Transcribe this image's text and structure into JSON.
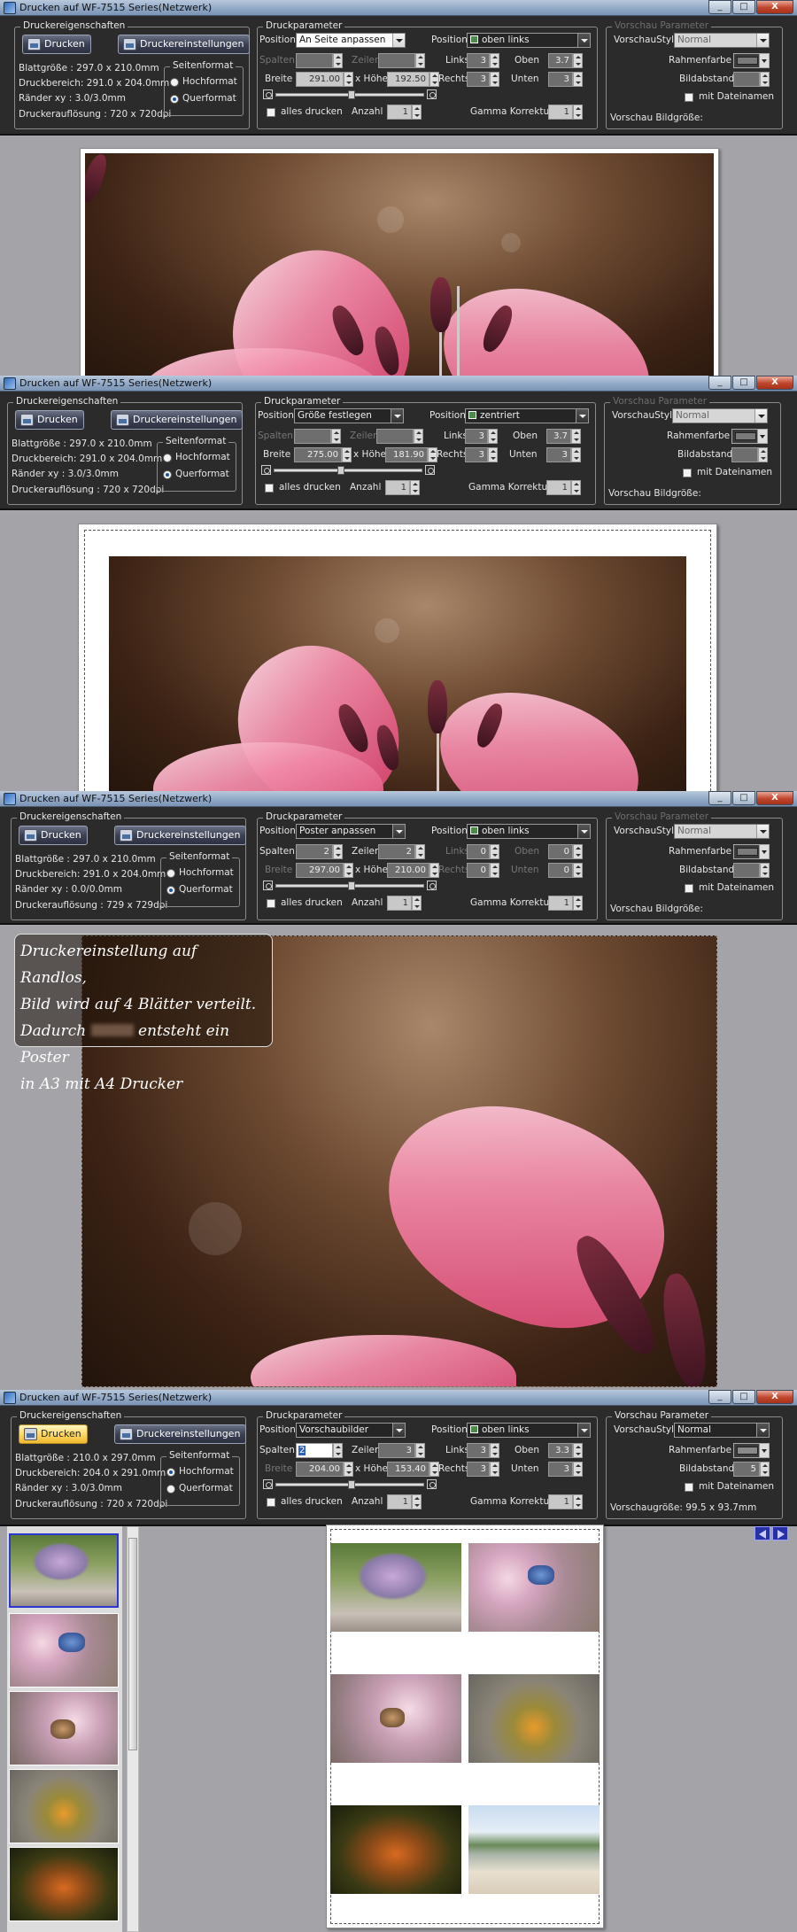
{
  "window": {
    "title": "Drucken auf WF-7515 Series(Netzwerk)",
    "buttons": {
      "minimize": "_",
      "maximize": "□",
      "close": "X"
    }
  },
  "labels": {
    "druckereigenschaften": "Druckereigenschaften",
    "drucken": "Drucken",
    "druckereinstellungen": "Druckereinstellungen",
    "blattgroesse": "Blattgröße",
    "druckbereich": "Druckbereich:",
    "raender": "Ränder xy",
    "druckaufloesung": "Druckerauflösung :",
    "seitenformat": "Seitenformat",
    "hochformat": "Hochformat",
    "querformat": "Querformat",
    "druckparameter": "Druckparameter",
    "position": "Position",
    "spalten": "Spalten",
    "zeilen": "Zeilen",
    "links": "Links",
    "oben": "Oben",
    "rechts": "Rechts",
    "unten": "Unten",
    "breite": "Breite",
    "x_hoehe": "x Höhe",
    "alles_drucken": "alles drucken",
    "anzahl": "Anzahl",
    "gamma": "Gamma Korrektur",
    "vorschau_parameter": "Vorschau Parameter",
    "vorschaustyle": "VorschauStyle",
    "rahmenfarbe": "Rahmenfarbe",
    "bildabstand": "Bildabstand",
    "mit_dateinamen": "mit Dateinamen"
  },
  "screens": [
    {
      "blatt": ": 297.0 x 210.0mm",
      "druckbereich": " 291.0 x 204.0mm",
      "raender": ": 3.0/3.0mm",
      "aufloesung": " 720 x 720dpi",
      "orientation": "Querformat",
      "position_mode": "An Seite anpassen",
      "position_anchor": "oben links",
      "spalten": "",
      "zeilen": "",
      "links": "3",
      "oben": "3.7",
      "rechts": "3",
      "unten": "3",
      "breite": "291.00",
      "hoehe": "192.50",
      "anzahl": "1",
      "gamma": "1",
      "vorschau_style": "Normal",
      "bildabstand": "",
      "bildgroesse": "Vorschau Bildgröße:",
      "preview_active": false
    },
    {
      "blatt": ": 297.0 x 210.0mm",
      "druckbereich": " 291.0 x 204.0mm",
      "raender": ": 3.0/3.0mm",
      "aufloesung": " 720 x 720dpi",
      "orientation": "Querformat",
      "position_mode": "Größe festlegen",
      "position_anchor": "zentriert",
      "spalten": "",
      "zeilen": "",
      "links": "3",
      "oben": "3.7",
      "rechts": "3",
      "unten": "3",
      "breite": "275.00",
      "hoehe": "181.90",
      "anzahl": "1",
      "gamma": "1",
      "vorschau_style": "Normal",
      "bildabstand": "",
      "bildgroesse": "Vorschau Bildgröße:",
      "preview_active": false
    },
    {
      "blatt": ": 297.0 x 210.0mm",
      "druckbereich": " 291.0 x 204.0mm",
      "raender": ": 0.0/0.0mm",
      "aufloesung": " 729 x 729dpi",
      "orientation": "Querformat",
      "position_mode": "Poster anpassen",
      "position_anchor": "oben links",
      "spalten": "2",
      "zeilen": "2",
      "links": "0",
      "oben": "0",
      "rechts": "0",
      "unten": "0",
      "breite": "297.00",
      "hoehe": "210.00",
      "anzahl": "1",
      "gamma": "1",
      "vorschau_style": "Normal",
      "bildabstand": "",
      "bildgroesse": "Vorschau Bildgröße:",
      "preview_active": false
    },
    {
      "blatt": ": 210.0 x 297.0mm",
      "druckbereich": " 204.0 x 291.0mm",
      "raender": ": 3.0/3.0mm",
      "aufloesung": " 720 x 720dpi",
      "orientation": "Hochformat",
      "position_mode": "Vorschaubilder",
      "position_anchor": "oben links",
      "spalten": "2",
      "zeilen": "3",
      "links": "3",
      "oben": "3.3",
      "rechts": "3",
      "unten": "3",
      "breite": "204.00",
      "hoehe": "153.40",
      "anzahl": "1",
      "gamma": "1",
      "vorschau_style": "Normal",
      "bildabstand": "5",
      "bildgroesse": "Vorschaugröße: 99.5 x 93.7mm",
      "preview_active": true
    }
  ],
  "annotation": {
    "line1": "Druckereinstellung auf Randlos,",
    "line2": "Bild wird auf 4 Blätter verteilt.",
    "line3a": "Dadurch",
    "line3b": "entsteht ein Poster",
    "line4": "in A3 mit A4 Drucker"
  },
  "colors": {
    "toolbar_bg": "#2b2b2b",
    "canvas_bg": "#a3a3a8",
    "titlebar": "#8ea6c4",
    "active_button": "#ffd968",
    "selection_border": "#2a3ad0"
  }
}
